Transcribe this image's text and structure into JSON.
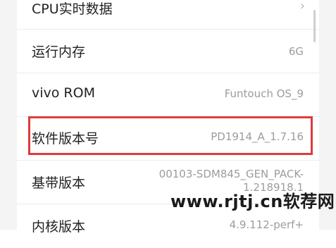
{
  "rows": [
    {
      "label": "CPU实时数据",
      "value": "",
      "chevron": true
    },
    {
      "label": "运行内存",
      "value": "6G"
    },
    {
      "label": "vivo ROM",
      "value": "Funtouch OS_9"
    },
    {
      "label": "软件版本号",
      "value": "PD1914_A_1.7.16"
    },
    {
      "label": "基带版本",
      "value_line1": "00103-SDM845_GEN_PACK-",
      "value_line2": "1.218918.1"
    },
    {
      "label": "内核版本",
      "value": "4.9.112-perf+"
    }
  ],
  "chevron_glyph": "›",
  "watermark": "www.rjtj.cn软荐网",
  "colors": {
    "highlight": "#e03a3a",
    "label": "#222222",
    "value": "#9c9c9c"
  }
}
